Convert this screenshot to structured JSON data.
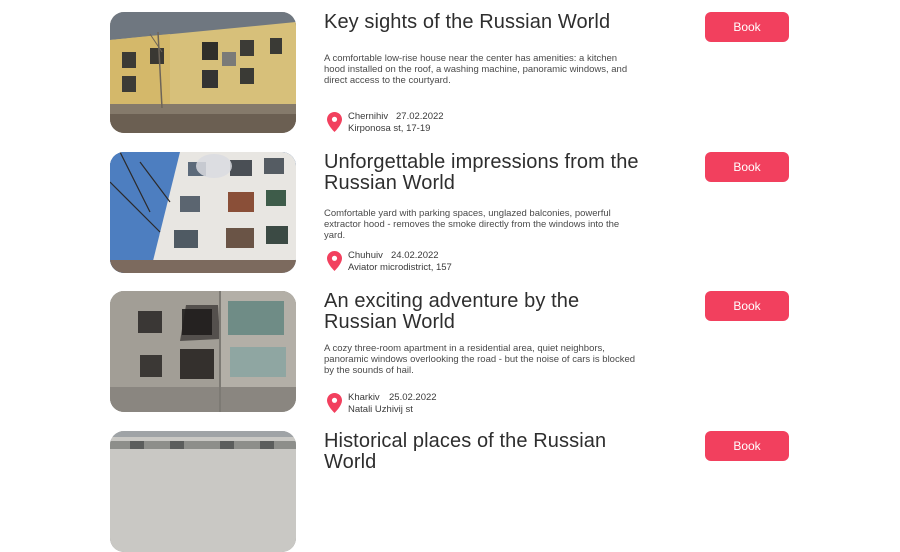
{
  "listings": [
    {
      "title": "Key sights of the Russian World",
      "description": "A comfortable low-rise house near the center has amenities: a kitchen hood installed on the roof, a washing machine, panoramic windows, and direct access to the courtyard.",
      "city": "Chernihiv",
      "date": "27.02.2022",
      "address": "Kirponosa st, 17-19",
      "book_label": "Book",
      "pin_icon": "location-pin-icon"
    },
    {
      "title": "Unforgettable impressions from the Russian World",
      "description": "Comfortable yard with parking spaces, unglazed balconies, powerful extractor hood - removes the smoke directly from the windows into the yard.",
      "city": "Chuhuiv",
      "date": "24.02.2022",
      "address": "Aviator microdistrict, 157",
      "book_label": "Book",
      "pin_icon": "location-pin-icon"
    },
    {
      "title": "An exciting adventure by the Russian World",
      "description": "A cozy three-room apartment in a residential area, quiet neighbors, panoramic windows overlooking the road - but the noise of cars is blocked by the sounds of hail.",
      "city": "Kharkiv",
      "date": "25.02.2022",
      "address": "Natali Uzhivij st",
      "book_label": "Book",
      "pin_icon": "location-pin-icon"
    },
    {
      "title": "Historical places of the Russian World",
      "book_label": "Book"
    }
  ],
  "colors": {
    "accent": "#f2405e",
    "title_text": "#2e2e2e",
    "body_text": "#4a4a4a"
  }
}
